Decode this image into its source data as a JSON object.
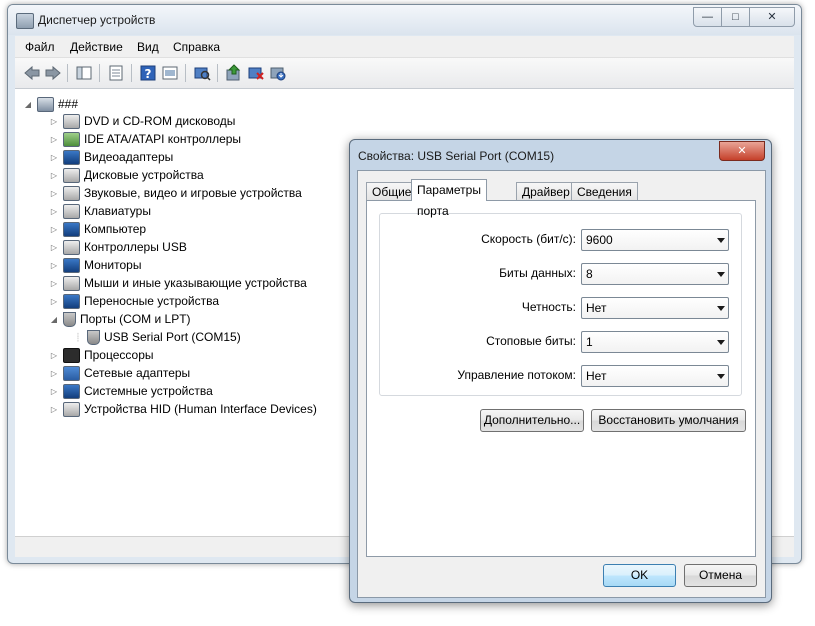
{
  "main_window": {
    "title": "Диспетчер устройств",
    "caption_buttons": {
      "minimize": "—",
      "maximize": "□",
      "close": "✕"
    }
  },
  "menu": [
    "Файл",
    "Действие",
    "Вид",
    "Справка"
  ],
  "toolbar": {
    "icons": [
      "back-arrow-icon",
      "forward-arrow-icon",
      "properties-pane-icon",
      "list-view-icon",
      "help-icon",
      "show-hidden-icon",
      "scan-hardware-icon",
      "update-driver-icon",
      "disable-device-icon",
      "uninstall-device-icon"
    ]
  },
  "tree": {
    "root": "###",
    "categories": [
      {
        "label": "DVD и CD-ROM дисководы",
        "icon": "dvd-drive-icon",
        "expanded": false
      },
      {
        "label": "IDE ATA/ATAPI контроллеры",
        "icon": "ide-controller-icon",
        "expanded": false
      },
      {
        "label": "Видеоадаптеры",
        "icon": "display-adapter-icon",
        "expanded": false
      },
      {
        "label": "Дисковые устройства",
        "icon": "disk-drive-icon",
        "expanded": false
      },
      {
        "label": "Звуковые, видео и игровые устройства",
        "icon": "speaker-icon",
        "expanded": false
      },
      {
        "label": "Клавиатуры",
        "icon": "keyboard-icon",
        "expanded": false
      },
      {
        "label": "Компьютер",
        "icon": "computer-icon",
        "expanded": false
      },
      {
        "label": "Контроллеры USB",
        "icon": "usb-icon",
        "expanded": false
      },
      {
        "label": "Мониторы",
        "icon": "monitor-icon",
        "expanded": false
      },
      {
        "label": "Мыши и иные указывающие устройства",
        "icon": "mouse-icon",
        "expanded": false
      },
      {
        "label": "Переносные устройства",
        "icon": "portable-device-icon",
        "expanded": false
      },
      {
        "label": "Порты (COM и LPT)",
        "icon": "port-icon",
        "expanded": true,
        "children": [
          "USB Serial Port (COM15)"
        ]
      },
      {
        "label": "Процессоры",
        "icon": "cpu-icon",
        "expanded": false
      },
      {
        "label": "Сетевые адаптеры",
        "icon": "network-adapter-icon",
        "expanded": false
      },
      {
        "label": "Системные устройства",
        "icon": "system-device-icon",
        "expanded": false
      },
      {
        "label": "Устройства HID (Human Interface Devices)",
        "icon": "hid-icon",
        "expanded": false
      }
    ]
  },
  "dialog": {
    "title": "Свойства: USB Serial Port (COM15)",
    "close_glyph": "✕",
    "tabs": [
      "Общие",
      "Параметры порта",
      "Драйвер",
      "Сведения"
    ],
    "active_tab": "Параметры порта",
    "fields": [
      {
        "label": "Скорость (бит/с):",
        "value": "9600"
      },
      {
        "label": "Биты данных:",
        "value": "8"
      },
      {
        "label": "Четность:",
        "value": "Нет"
      },
      {
        "label": "Стоповые биты:",
        "value": "1"
      },
      {
        "label": "Управление потоком:",
        "value": "Нет"
      }
    ],
    "advanced_button": "Дополнительно...",
    "restore_defaults_button": "Восстановить умолчания",
    "ok_button": "OK",
    "cancel_button": "Отмена"
  }
}
